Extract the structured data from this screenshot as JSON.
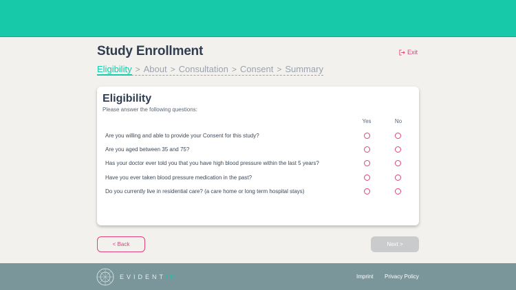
{
  "header": {
    "title": "Study Enrollment",
    "exit_label": "Exit"
  },
  "breadcrumb": {
    "items": [
      {
        "label": "Eligibility",
        "active": true
      },
      {
        "label": "About",
        "active": false
      },
      {
        "label": "Consultation",
        "active": false
      },
      {
        "label": "Consent",
        "active": false
      },
      {
        "label": "Summary",
        "active": false
      }
    ],
    "separator": ">"
  },
  "card": {
    "title": "Eligibility",
    "subtitle": "Please answer the following questions:",
    "col_yes": "Yes",
    "col_no": "No",
    "questions": [
      "Are you willing and able to provide your Consent for this study?",
      "Are you aged between 35 and 75?",
      "Has your doctor ever told you that you have high blood pressure within the last 5 years?",
      "Have you ever taken blood pressure medication in the past?",
      "Do you currently live in residential care? (a care home or long term hospital stays)"
    ]
  },
  "actions": {
    "back_label": "< Back",
    "next_label": "Next >"
  },
  "footer": {
    "logo_main": "EVIDENT",
    "logo_accent": "IQ",
    "imprint_label": "Imprint",
    "privacy_label": "Privacy Policy"
  },
  "colors": {
    "brand_teal": "#17c9a8",
    "accent_pink": "#e0407a",
    "footer_bg": "#7a969b",
    "text_dark": "#2f3d4f"
  }
}
